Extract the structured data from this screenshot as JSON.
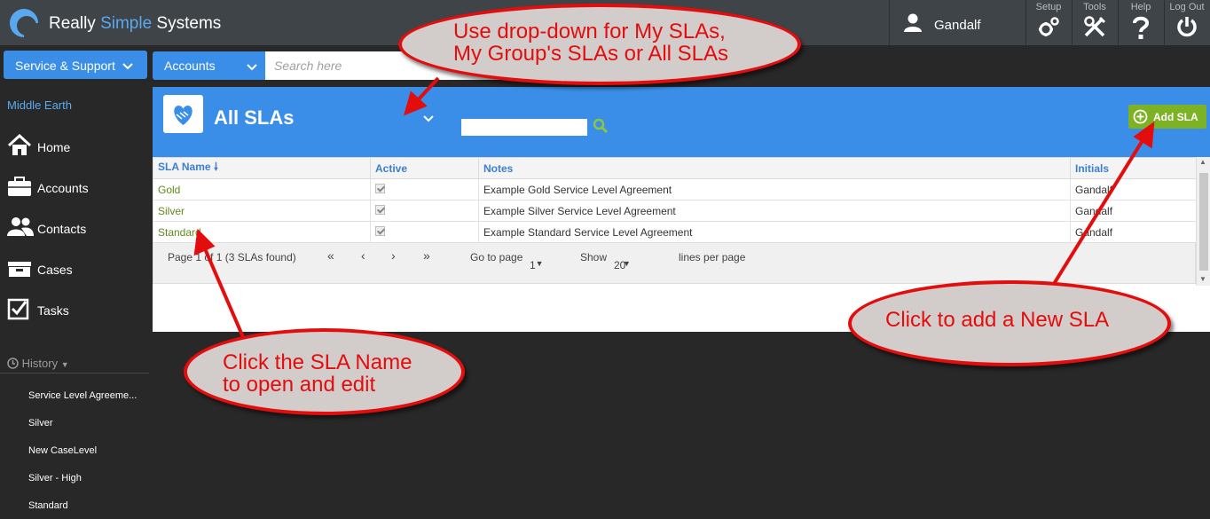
{
  "topbar": {
    "brand_prefix": "Really ",
    "brand_accent": "Simple",
    "brand_suffix": " Systems",
    "user_name": "Gandalf",
    "buttons": [
      {
        "label": "Setup",
        "icon": "gear-icon"
      },
      {
        "label": "Tools",
        "icon": "tools-icon"
      },
      {
        "label": "Help",
        "icon": "question-icon"
      },
      {
        "label": "Log Out",
        "icon": "power-icon"
      }
    ]
  },
  "toolbar": {
    "module_label": "Service & Support",
    "search_scope": "Accounts",
    "search_placeholder": "Search here"
  },
  "sidebar": {
    "org_name": "Middle Earth",
    "items": [
      {
        "label": "Home",
        "icon": "home-icon"
      },
      {
        "label": "Accounts",
        "icon": "briefcase-icon"
      },
      {
        "label": "Contacts",
        "icon": "contacts-icon"
      },
      {
        "label": "Cases",
        "icon": "inbox-icon"
      },
      {
        "label": "Tasks",
        "icon": "checkbox-icon"
      }
    ],
    "history_label": "History",
    "history": [
      "Service Level Agreeme...",
      "Silver",
      "New CaseLevel",
      "Silver - High",
      "Standard"
    ]
  },
  "panel": {
    "title": "All SLAs",
    "add_label": "Add SLA",
    "columns": [
      "SLA Name",
      "Active",
      "Notes",
      "Initials"
    ],
    "rows": [
      {
        "name": "Gold",
        "active": true,
        "notes": "Example Gold Service Level Agreement",
        "initials": "Gandalf"
      },
      {
        "name": "Silver",
        "active": true,
        "notes": "Example Silver Service Level Agreement",
        "initials": "Gandalf"
      },
      {
        "name": "Standard",
        "active": true,
        "notes": "Example Standard Service Level Agreement",
        "initials": "Gandalf"
      }
    ],
    "pager": {
      "summary": "Page 1 of 1 (3 SLAs found)",
      "first": "«",
      "prev": "‹",
      "next": "›",
      "last": "»",
      "goto_label": "Go to page",
      "goto_value": "1",
      "show_label": "Show",
      "show_value": "20",
      "per_page_label": "lines per page"
    }
  },
  "annotations": {
    "dropdown_note_1": "Use drop-down for My SLAs,",
    "dropdown_note_2": "My Group's SLAs or All SLAs",
    "name_note_1": "Click the SLA Name",
    "name_note_2": "to open and edit",
    "add_note": "Click to add a New SLA"
  },
  "colors": {
    "accent_blue": "#3b8ee8",
    "add_green": "#7cb224",
    "annotation_red": "#e30d0d"
  }
}
